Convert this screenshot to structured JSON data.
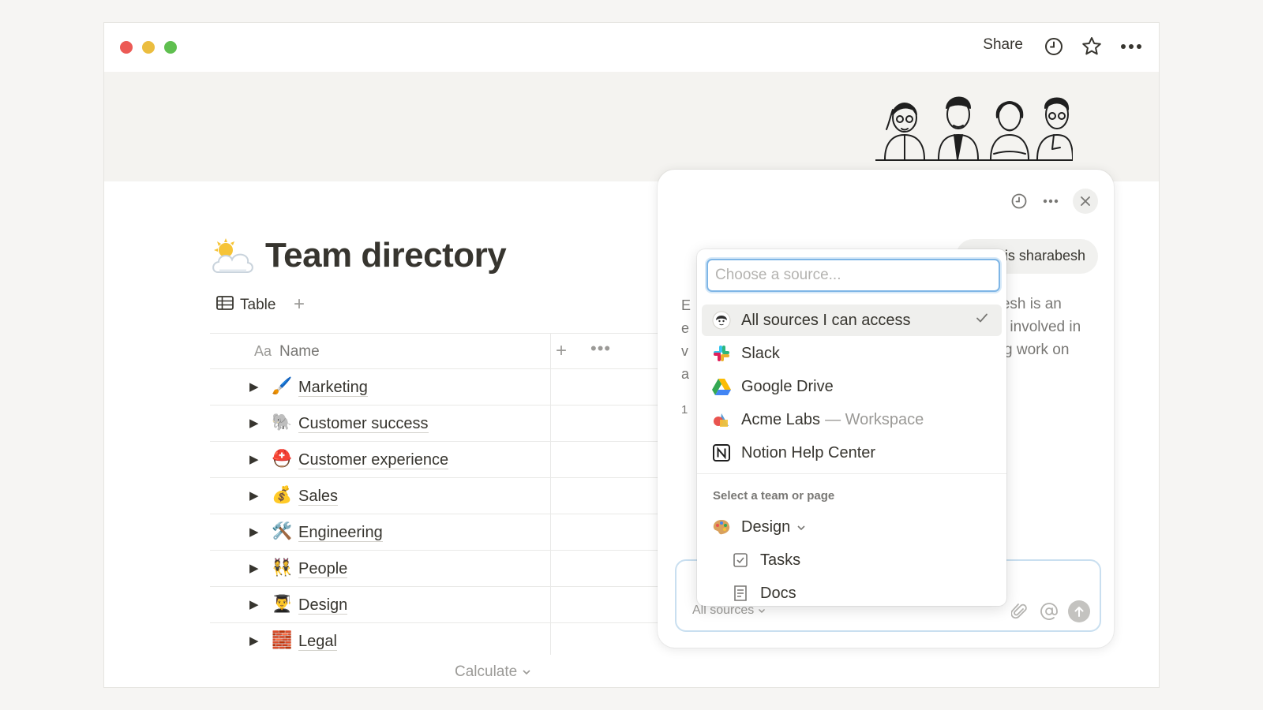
{
  "titlebar": {
    "share_label": "Share",
    "icons": [
      "clock-icon",
      "star-icon",
      "more-icon"
    ]
  },
  "page": {
    "icon": "sun-behind-cloud",
    "title": "Team directory"
  },
  "view": {
    "tab_label": "Table",
    "add_label": "+"
  },
  "table": {
    "header": {
      "type_prefix": "Aa",
      "name": "Name",
      "add_column": "+",
      "more": "•••"
    },
    "rows": [
      {
        "emoji": "🖌️",
        "label": "Marketing"
      },
      {
        "emoji": "🐘",
        "label": "Customer success"
      },
      {
        "emoji": "⛑️",
        "label": "Customer experience"
      },
      {
        "emoji": "💰",
        "label": "Sales"
      },
      {
        "emoji": "🛠️",
        "label": "Engineering"
      },
      {
        "emoji": "👯",
        "label": "People"
      },
      {
        "emoji": "👨‍🎓",
        "label": "Design"
      },
      {
        "emoji": "🧱",
        "label": "Legal"
      }
    ],
    "calculate_label": "Calculate"
  },
  "chat": {
    "bubble_text": "o is sharabesh",
    "answer_lines": [
      "mesh is an",
      "be involved in",
      "ling work on"
    ],
    "stray_chars": [
      "E",
      "e",
      "v",
      "a",
      "1"
    ],
    "composer": {
      "source_label": "All sources"
    }
  },
  "source_menu": {
    "placeholder": "Choose a source...",
    "items": [
      {
        "label": "All sources I can access",
        "sub": "",
        "icon": "avatar-icon",
        "selected": true
      },
      {
        "label": "Slack",
        "sub": "",
        "icon": "slack-icon",
        "selected": false
      },
      {
        "label": "Google Drive",
        "sub": "",
        "icon": "google-drive-icon",
        "selected": false
      },
      {
        "label": "Acme Labs",
        "sub": "— Workspace",
        "icon": "acme-labs-icon",
        "selected": false
      },
      {
        "label": "Notion Help Center",
        "sub": "",
        "icon": "notion-icon",
        "selected": false
      }
    ],
    "section_label": "Select a team or page",
    "team": {
      "label": "Design",
      "icon": "palette-icon"
    },
    "pages": [
      {
        "label": "Tasks",
        "icon": "checkbox-icon"
      },
      {
        "label": "Docs",
        "icon": "page-icon"
      }
    ]
  },
  "colors": {
    "accent": "#7fb6e6",
    "text": "#37352f",
    "muted": "#9b9a97"
  }
}
